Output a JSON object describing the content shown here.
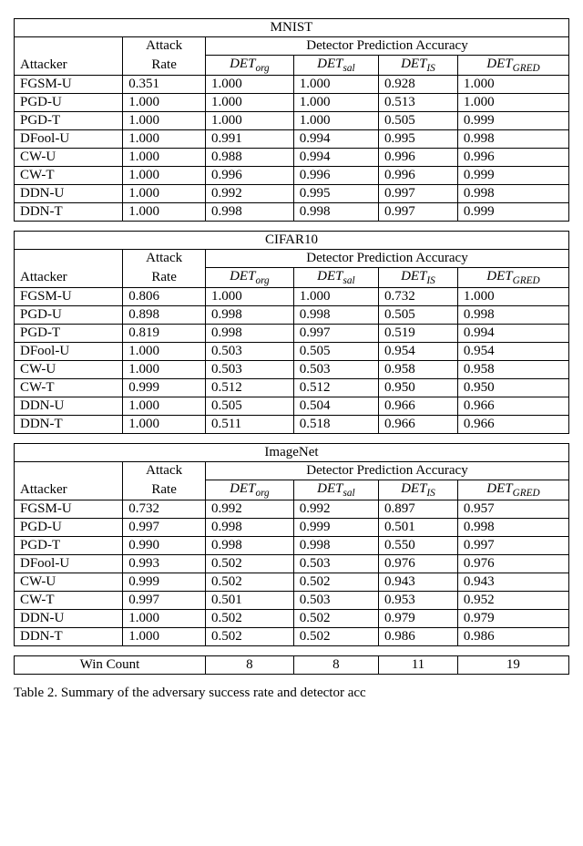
{
  "chart_data": {
    "type": "table",
    "columns": [
      "DET_org",
      "DET_sal",
      "DET_IS",
      "DET_GRED"
    ],
    "blocks": [
      {
        "name": "MNIST",
        "rows": [
          {
            "attacker": "FGSM-U",
            "rate": "0.351",
            "vals": [
              "1.000",
              "1.000",
              "0.928",
              "1.000"
            ],
            "bold": [
              true,
              true,
              false,
              true
            ]
          },
          {
            "attacker": "PGD-U",
            "rate": "1.000",
            "vals": [
              "1.000",
              "1.000",
              "0.513",
              "1.000"
            ],
            "bold": [
              true,
              true,
              false,
              true
            ]
          },
          {
            "attacker": "PGD-T",
            "rate": "1.000",
            "vals": [
              "1.000",
              "1.000",
              "0.505",
              "0.999"
            ],
            "bold": [
              true,
              true,
              false,
              true
            ]
          },
          {
            "attacker": "DFool-U",
            "rate": "1.000",
            "vals": [
              "0.991",
              "0.994",
              "0.995",
              "0.998"
            ],
            "bold": [
              false,
              false,
              false,
              true
            ]
          },
          {
            "attacker": "CW-U",
            "rate": "1.000",
            "vals": [
              "0.988",
              "0.994",
              "0.996",
              "0.996"
            ],
            "bold": [
              false,
              false,
              true,
              true
            ]
          },
          {
            "attacker": "CW-T",
            "rate": "1.000",
            "vals": [
              "0.996",
              "0.996",
              "0.996",
              "0.999"
            ],
            "bold": [
              false,
              false,
              false,
              true
            ]
          },
          {
            "attacker": "DDN-U",
            "rate": "1.000",
            "vals": [
              "0.992",
              "0.995",
              "0.997",
              "0.998"
            ],
            "bold": [
              false,
              false,
              false,
              true
            ]
          },
          {
            "attacker": "DDN-T",
            "rate": "1.000",
            "vals": [
              "0.998",
              "0.998",
              "0.997",
              "0.999"
            ],
            "bold": [
              false,
              false,
              false,
              true
            ]
          }
        ]
      },
      {
        "name": "CIFAR10",
        "rows": [
          {
            "attacker": "FGSM-U",
            "rate": "0.806",
            "vals": [
              "1.000",
              "1.000",
              "0.732",
              "1.000"
            ],
            "bold": [
              true,
              true,
              false,
              true
            ]
          },
          {
            "attacker": "PGD-U",
            "rate": "0.898",
            "vals": [
              "0.998",
              "0.998",
              "0.505",
              "0.998"
            ],
            "bold": [
              true,
              true,
              false,
              true
            ]
          },
          {
            "attacker": "PGD-T",
            "rate": "0.819",
            "vals": [
              "0.998",
              "0.997",
              "0.519",
              "0.994"
            ],
            "bold": [
              true,
              false,
              false,
              false
            ]
          },
          {
            "attacker": "DFool-U",
            "rate": "1.000",
            "vals": [
              "0.503",
              "0.505",
              "0.954",
              "0.954"
            ],
            "bold": [
              false,
              false,
              true,
              true
            ]
          },
          {
            "attacker": "CW-U",
            "rate": "1.000",
            "vals": [
              "0.503",
              "0.503",
              "0.958",
              "0.958"
            ],
            "bold": [
              false,
              false,
              true,
              true
            ]
          },
          {
            "attacker": "CW-T",
            "rate": "0.999",
            "vals": [
              "0.512",
              "0.512",
              "0.950",
              "0.950"
            ],
            "bold": [
              false,
              false,
              true,
              true
            ]
          },
          {
            "attacker": "DDN-U",
            "rate": "1.000",
            "vals": [
              "0.505",
              "0.504",
              "0.966",
              "0.966"
            ],
            "bold": [
              false,
              false,
              true,
              true
            ]
          },
          {
            "attacker": "DDN-T",
            "rate": "1.000",
            "vals": [
              "0.511",
              "0.518",
              "0.966",
              "0.966"
            ],
            "bold": [
              false,
              false,
              true,
              true
            ]
          }
        ]
      },
      {
        "name": "ImageNet",
        "rows": [
          {
            "attacker": "FGSM-U",
            "rate": "0.732",
            "vals": [
              "0.992",
              "0.992",
              "0.897",
              "0.957"
            ],
            "bold": [
              true,
              true,
              false,
              false
            ]
          },
          {
            "attacker": "PGD-U",
            "rate": "0.997",
            "vals": [
              "0.998",
              "0.999",
              "0.501",
              "0.998"
            ],
            "bold": [
              false,
              true,
              false,
              false
            ]
          },
          {
            "attacker": "PGD-T",
            "rate": "0.990",
            "vals": [
              "0.998",
              "0.998",
              "0.550",
              "0.997"
            ],
            "bold": [
              true,
              true,
              false,
              false
            ]
          },
          {
            "attacker": "DFool-U",
            "rate": "0.993",
            "vals": [
              "0.502",
              "0.503",
              "0.976",
              "0.976"
            ],
            "bold": [
              false,
              false,
              true,
              true
            ]
          },
          {
            "attacker": "CW-U",
            "rate": "0.999",
            "vals": [
              "0.502",
              "0.502",
              "0.943",
              "0.943"
            ],
            "bold": [
              false,
              false,
              true,
              true
            ]
          },
          {
            "attacker": "CW-T",
            "rate": "0.997",
            "vals": [
              "0.501",
              "0.503",
              "0.953",
              "0.952"
            ],
            "bold": [
              false,
              false,
              true,
              false
            ]
          },
          {
            "attacker": "DDN-U",
            "rate": "1.000",
            "vals": [
              "0.502",
              "0.502",
              "0.979",
              "0.979"
            ],
            "bold": [
              false,
              false,
              true,
              true
            ]
          },
          {
            "attacker": "DDN-T",
            "rate": "1.000",
            "vals": [
              "0.502",
              "0.502",
              "0.986",
              "0.986"
            ],
            "bold": [
              false,
              false,
              true,
              true
            ]
          }
        ]
      }
    ],
    "win_count": {
      "label": "Win Count",
      "vals": [
        "8",
        "8",
        "11",
        "19"
      ]
    }
  },
  "labels": {
    "attacker": "Attacker",
    "attack": "Attack",
    "rate": "Rate",
    "dpa": "Detector Prediction Accuracy",
    "caption": "Table 2. Summary of the adversary success rate and detector acc"
  },
  "det": {
    "base": "DET",
    "sub": [
      "org",
      "sal",
      "IS",
      "GRED"
    ]
  }
}
